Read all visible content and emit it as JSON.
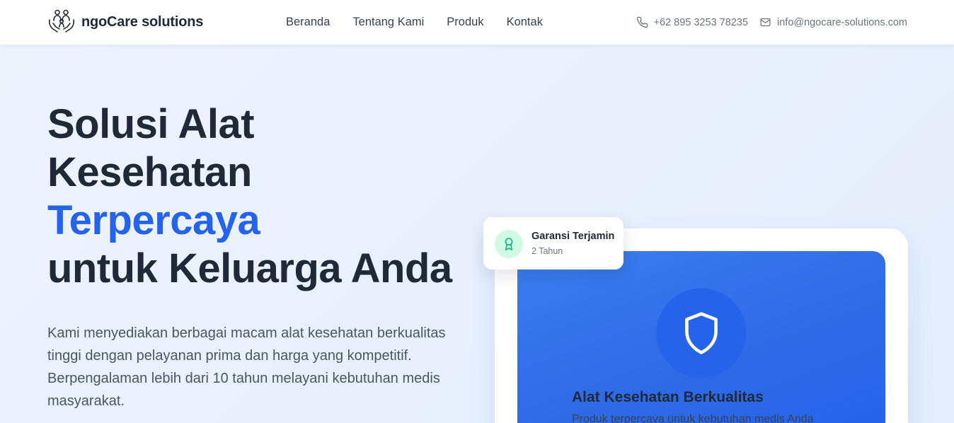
{
  "brand": {
    "name": "ngoCare solutions",
    "logo_icon": "family-care-hands-icon"
  },
  "nav": {
    "items": [
      {
        "label": "Beranda"
      },
      {
        "label": "Tentang Kami"
      },
      {
        "label": "Produk"
      },
      {
        "label": "Kontak"
      }
    ]
  },
  "contact": {
    "phone": {
      "icon": "phone-icon",
      "text": "+62 895 3253 78235"
    },
    "email": {
      "icon": "mail-icon",
      "text": "info@ngocare-solutions.com"
    }
  },
  "hero": {
    "title_line1": "Solusi Alat",
    "title_line2": "Kesehatan",
    "title_accent": "Terpercaya",
    "title_line4": "untuk Keluarga Anda",
    "description": "Kami menyediakan berbagai macam alat kesehatan berkualitas tinggi dengan pelayanan prima dan harga yang kompetitif. Berpengalaman lebih dari 10 tahun melayani kebutuhan medis masyarakat."
  },
  "badge": {
    "icon": "award-ribbon-icon",
    "title": "Garansi Terjamin",
    "subtitle": "2 Tahun"
  },
  "feature_card": {
    "icon": "shield-icon",
    "title": "Alat Kesehatan Berkualitas",
    "subtitle": "Produk terpercaya untuk kebutuhan medis Anda"
  },
  "colors": {
    "accent": "#2563eb",
    "text_dark": "#1f2937",
    "badge_icon_bg": "#d1fae5",
    "badge_icon_stroke": "#10b981"
  }
}
